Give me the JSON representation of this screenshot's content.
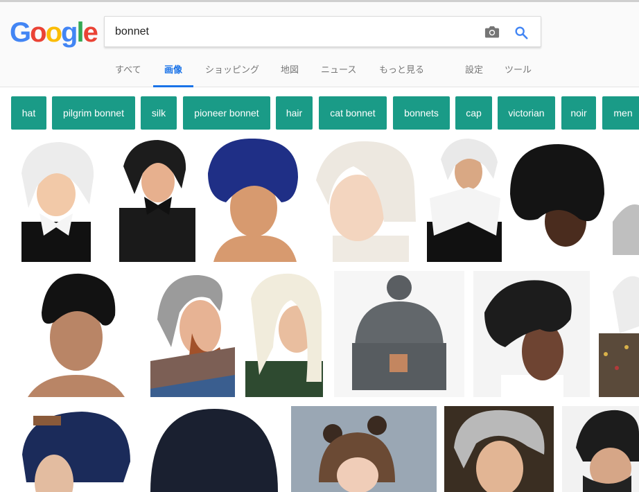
{
  "search": {
    "query": "bonnet"
  },
  "logo": {
    "letters": [
      "G",
      "o",
      "o",
      "g",
      "l",
      "e"
    ],
    "colors": [
      "#4285f4",
      "#ea4335",
      "#fbbc05",
      "#4285f4",
      "#34a853",
      "#ea4335"
    ]
  },
  "tabs": [
    "すべて",
    "画像",
    "ショッピング",
    "地図",
    "ニュース",
    "もっと見る",
    "設定",
    "ツール"
  ],
  "active_tab": "画像",
  "chips": [
    "hat",
    "pilgrim bonnet",
    "silk",
    "pioneer bonnet",
    "hair",
    "cat bonnet",
    "bonnets",
    "cap",
    "victorian",
    "noir",
    "men"
  ],
  "colors": {
    "accent": "#1a73e8",
    "chip_bg": "#1a9b87"
  },
  "results": [
    "white bonnet girl",
    "black bonnet woman",
    "navy satin bonnet",
    "cream baby bonnet",
    "pilgrim bonnet woman",
    "black hooded hair dryer bonnet",
    "black satin sleep cap",
    "grey hood bearded man",
    "cream hood woman",
    "grey knit beanie",
    "satin bonnet profile",
    "floral bonnet",
    "navy knit slouch hat",
    "navy knit beanie",
    "bear ear baby bonnet",
    "grey bonnet girl",
    "knit beard hat"
  ]
}
